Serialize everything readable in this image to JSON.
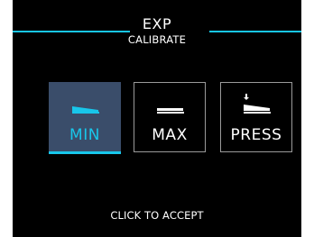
{
  "header": {
    "title": "EXP",
    "subtitle": "CALIBRATE"
  },
  "options": [
    {
      "label": "MIN",
      "icon": "pedal-min-icon",
      "selected": true
    },
    {
      "label": "MAX",
      "icon": "pedal-max-icon",
      "selected": false
    },
    {
      "label": "PRESS",
      "icon": "pedal-press-icon",
      "selected": false
    }
  ],
  "footer": {
    "instruction": "CLICK TO ACCEPT"
  },
  "colors": {
    "accent": "#18c6ea",
    "selected_bg": "#3a4d6a",
    "screen_bg": "#000000",
    "border": "#9a9a9a"
  }
}
